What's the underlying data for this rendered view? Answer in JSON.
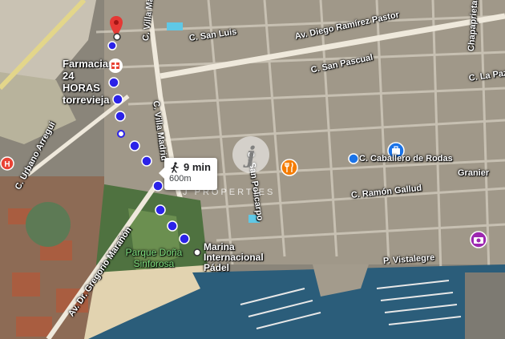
{
  "map": {
    "streets": [
      {
        "id": "calle-villa-madrid-top",
        "label": "C. Villa Madrid"
      },
      {
        "id": "calle-san-luis",
        "label": "C. San Luis"
      },
      {
        "id": "av-diego-ramirez-pastor",
        "label": "Av. Diego Ramírez Pastor"
      },
      {
        "id": "calle-san-pascual",
        "label": "C. San Pascual"
      },
      {
        "id": "calle-la-paz",
        "label": "C. La Paz"
      },
      {
        "id": "calle-chapaprieta",
        "label": "Chapaprieta"
      },
      {
        "id": "calle-san-policarpo",
        "label": "C. San Policarpo"
      },
      {
        "id": "calle-villa-madrid",
        "label": "C. Villa Madrid"
      },
      {
        "id": "calle-urbano-arregui",
        "label": "C. Urbano Arregui"
      },
      {
        "id": "calle-caballero-de-rodas",
        "label": "C. Caballero de Rodas"
      },
      {
        "id": "calle-ramon-gallud",
        "label": "C. Ramón Gallud"
      },
      {
        "id": "granier",
        "label": "Granier"
      },
      {
        "id": "av-dr-gregorio-maranon",
        "label": "Av. Dr. Gregorio Marañón"
      },
      {
        "id": "paseo-vistalegre",
        "label": "P. Vistalegre"
      }
    ],
    "parks": [
      {
        "label": "Parque Doña Sinforosa"
      }
    ],
    "pois": [
      {
        "label": "Farmacia 24 HORAS torrevieja",
        "icon": "pharmacy-icon",
        "color": "#e94335"
      },
      {
        "label": "",
        "icon": "restaurant-icon",
        "color": "#f57c00"
      },
      {
        "label": "",
        "icon": "shopping-icon",
        "color": "#1a73e8"
      },
      {
        "label": "",
        "icon": "camera-icon",
        "color": "#9c27b0"
      },
      {
        "label": "",
        "icon": "hospital-icon",
        "color": "#e94335"
      }
    ],
    "destination": {
      "label": "Marina Internacional Pádel"
    },
    "route": {
      "mode": "walking",
      "time": "9 min",
      "distance": "600m",
      "color": "#1a1aff"
    },
    "watermark": {
      "logo": "j",
      "text": "IJ PROPERTIES"
    },
    "colors": {
      "route": "#2b22e8",
      "origin_pin": "#e53935",
      "sea": "#2b5d7a",
      "park": "#3d7a3a"
    }
  }
}
